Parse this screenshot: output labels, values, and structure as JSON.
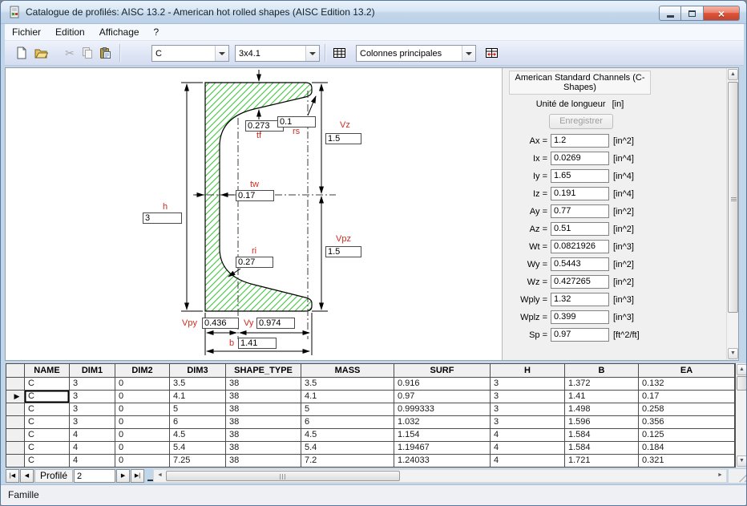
{
  "window": {
    "title": "Catalogue de profilés: AISC 13.2 - American hot rolled shapes (AISC Edition 13.2)"
  },
  "menu": {
    "items": [
      {
        "label": "Fichier"
      },
      {
        "label": "Edition"
      },
      {
        "label": "Affichage"
      },
      {
        "label": "?"
      }
    ]
  },
  "toolbar": {
    "profile_family": "C",
    "profile_size": "3x4.1",
    "columns_mode": "Colonnes principales"
  },
  "diagram": {
    "dims": {
      "tf": {
        "label": "tf",
        "value": "0.273"
      },
      "rs": {
        "label": "rs",
        "value": "0.1"
      },
      "Vz": {
        "label": "Vz",
        "value": "1.5"
      },
      "tw": {
        "label": "tw",
        "value": "0.17"
      },
      "h": {
        "label": "h",
        "value": "3"
      },
      "ri": {
        "label": "ri",
        "value": "0.27"
      },
      "Vpz": {
        "label": "Vpz",
        "value": "1.5"
      },
      "Vpy": {
        "label": "Vpy",
        "value": "0.436"
      },
      "Vy": {
        "label": "Vy",
        "value": "0.974"
      },
      "b": {
        "label": "b",
        "value": "1.41"
      }
    }
  },
  "properties": {
    "header": "American Standard Channels (C-Shapes)",
    "unit_label": "Unité de longueur",
    "unit_value": "[in]",
    "save_button": "Enregistrer",
    "fields": [
      {
        "label": "Ax =",
        "value": "1.2",
        "unit": "[in^2]"
      },
      {
        "label": "Ix =",
        "value": "0.0269",
        "unit": "[in^4]"
      },
      {
        "label": "Iy =",
        "value": "1.65",
        "unit": "[in^4]"
      },
      {
        "label": "Iz =",
        "value": "0.191",
        "unit": "[in^4]"
      },
      {
        "label": "Ay =",
        "value": "0.77",
        "unit": "[in^2]",
        "gap": true
      },
      {
        "label": "Az =",
        "value": "0.51",
        "unit": "[in^2]"
      },
      {
        "label": "Wt =",
        "value": "0.0821926",
        "unit": "[in^3]",
        "gap": true
      },
      {
        "label": "Wy =",
        "value": "0.5443",
        "unit": "[in^2]"
      },
      {
        "label": "Wz =",
        "value": "0.427265",
        "unit": "[in^2]"
      },
      {
        "label": "Wply =",
        "value": "1.32",
        "unit": "[in^3]",
        "gap": true
      },
      {
        "label": "Wplz =",
        "value": "0.399",
        "unit": "[in^3]"
      },
      {
        "label": "Sp =",
        "value": "0.97",
        "unit": "[ft^2/ft]",
        "gap": true
      }
    ]
  },
  "table": {
    "columns": [
      {
        "label": "NAME"
      },
      {
        "label": "DIM1"
      },
      {
        "label": "DIM2"
      },
      {
        "label": "DIM3"
      },
      {
        "label": "SHAPE_TYPE"
      },
      {
        "label": "MASS"
      },
      {
        "label": "SURF"
      },
      {
        "label": "H"
      },
      {
        "label": "B"
      },
      {
        "label": "EA"
      }
    ],
    "rows": [
      {
        "cells": [
          "C",
          "3",
          "0",
          "3.5",
          "38",
          "3.5",
          "0.916",
          "3",
          "1.372",
          "0.132"
        ]
      },
      {
        "cells": [
          "C",
          "3",
          "0",
          "4.1",
          "38",
          "4.1",
          "0.97",
          "3",
          "1.41",
          "0.17"
        ],
        "current": true
      },
      {
        "cells": [
          "C",
          "3",
          "0",
          "5",
          "38",
          "5",
          "0.999333",
          "3",
          "1.498",
          "0.258"
        ]
      },
      {
        "cells": [
          "C",
          "3",
          "0",
          "6",
          "38",
          "6",
          "1.032",
          "3",
          "1.596",
          "0.356"
        ]
      },
      {
        "cells": [
          "C",
          "4",
          "0",
          "4.5",
          "38",
          "4.5",
          "1.154",
          "4",
          "1.584",
          "0.125"
        ]
      },
      {
        "cells": [
          "C",
          "4",
          "0",
          "5.4",
          "38",
          "5.4",
          "1.19467",
          "4",
          "1.584",
          "0.184"
        ]
      },
      {
        "cells": [
          "C",
          "4",
          "0",
          "7.25",
          "38",
          "7.2",
          "1.24033",
          "4",
          "1.721",
          "0.321"
        ]
      }
    ]
  },
  "navigator": {
    "label": "Profilé",
    "record": "2"
  },
  "statusbar": {
    "text": "Famille"
  }
}
